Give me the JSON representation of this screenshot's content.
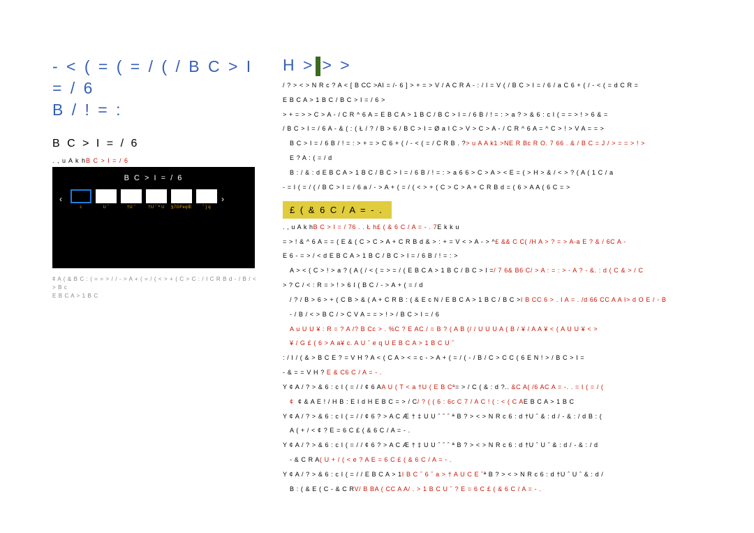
{
  "title": "- < ( = ( = / (   / B C > I = / 6\nB / ! =   :",
  "subtitle": "B C > I = / 6",
  "path": {
    "prefix": ". , u A k  h",
    "suffix": "B C > I = / 6"
  },
  "blackbox": {
    "title": "B C > I = / 6",
    "cells": [
      {
        "name": "c",
        "sel": true,
        "filled": false
      },
      {
        "name": "U ˆ",
        "sel": false,
        "filled": true
      },
      {
        "name": "†U ˆ",
        "sel": false,
        "filled": true
      },
      {
        "name": "†U ˆ ª U",
        "sel": false,
        "filled": true
      },
      {
        "name": "§7GFeqŒ",
        "sel": false,
        "filled": true
      },
      {
        "name": "ˆ ] q",
        "sel": false,
        "filled": true
      }
    ]
  },
  "footnote1": "¢ A ( & B C   : ( = = > /  / - >  A  + ( = / (  < > + ( C  > C : / I  C R B d   -  / B / < > B c",
  "footnote2": "E B C A > 1 B C",
  "right_title_prefix": "H >",
  "right_title_suffix": ">      >",
  "r1": "/ ?  > < > N R c   ?   A  < [ B CC >AI = /- 6 ]  > + = >     V   / A   C R   A   - : / I = V (   / B C > I = / 6 / a     C   6 + (   / - < ( = d C R  =",
  "r2": "E B C A > 1 B C   / B C > I = / 6 >",
  "r3": "> + = >  > C >  A   - / C R  ^ 6 A  =   E B C A > 1 B C    / B C > I = / 6   B / ! =  : >   a  ? > & 6 : c I ( = = > ! >   6  &  =",
  "r4": "/ B C > I = / 6    A  - & ( : (  Ł / ? / B > 6   / B C > I = Ø a I C >  V  > C >  A   - / C R  ^ 6 A  =  ^ C > ! >    V   A  = = >",
  "r5a": "B C > I = / 6  B / ! =   :   > + = >   C  6 + (  / - < ( = / C R  B . ?",
  "r5b": "> u A A k1 >NE R Bc R O. 7 66 . &  /  B C  = J /  > = = > ! >",
  "r6": "E ? A   : ( = / d",
  "r7": "B : /   & : d  E B C A > 1 B C    / B C > I = / 6   B / ! =  : >   a   6  6 > C > A > < E   = (  >  H > & / < >  ? ( A ( 1 C / a",
  "r8": "- =  I ( = / (   / B C > I = / 6   a  / - >  A   + ( = / (  < > + ( C  > C >  A   +   C R B d   = ( 6 > A A ( 6 C = >",
  "hl": "£ ( &   6 C / A     =   -  .",
  "r9a": ". , u A k  h",
  "r9b": "B C > I = / 76   . . Ł h",
  "r9c": "£ ( &  6 C / A   =  -  .   7",
  "r9d": "E k     k u",
  "r10a": "= > ! &  ^ 6 A  =  =  (   E & ( C  > C >  A  +  C R B d  & > : + = V <   >  A  - > ^",
  "r10b": "£  &&    C C( /H A  > ? = > A-a    E ? & / 6C    A  -",
  "r11": "E 6   -   = >   / < d   E B C A > 1 B C    / B C > I = / 6   B / ! =  : >",
  "r12a": "A > < (  C > ! > a  ? ( A ( / < ( = >    = / (  E B C A > 1 B C    / B C > I =",
  "r12b": "/ 7 6&    B6 C/ > A : =    : > -     A  ? - &.  : d ( C   &  >  / C",
  "r13": "> ? C / < : R = > ! >  6  I ( B C    / - >  A   + ( = / d",
  "r14a": "/ ? / B > 6   > + ( C  B > & ( A +  C R  B : ( & E c N /   E B C A > 1 B C    / B C >",
  "r14b": "I B  CC 6  > . I A = . /d 66 CC    A A I> d O E   / -  B",
  "r15": "-  / B / < > B C /  > C    V  A  = = > ! >   / B C > I = / 6",
  "r16a": "A u U  U ¥   : R =   ? A /",
  "r16b": "? B Cc  > . %C ?   E AC / =  B ? ( A B (/   / U  U  U  A ( B /  ¥ / A  A     ¥  < ( A   U    U ¥  < >",
  "r17a": "¥  / G   £ ( 6 > A a",
  "r17b": "¥ c. A U  ˆ   e q U E B C A > 1 B C    U  ˆ",
  "r18a": ": / I / (  & > B C E ? = V H   ?   A  < ( C A >     < = c   -  >   A  + ( = / (   -   / B / C  > C  C ( 6 E N ! >   / B C > I =",
  "r18b": "-  &   = = V H   ?",
  "r18c": "  E  &  C6 C / A    =   -  .",
  "r19a": "Y   ¢ A /  ? > & 6 : c I ( = / /  ¢  6  A",
  "r19b": "A U ( T  < a  †U  ( E B Cª",
  "r19c": "= >  / C (  & : d  ?..",
  "r19d": "  &C A( /6 AC  A      =   -.  .     =   I ( = / (",
  "r20": "¢     & A E ! / H  B : E I  d H  E B C  = >  / C",
  "r20b": "/ ? (  ( 6 : 6c C 7 / A C ! (  :    < ( C A",
  "r20c": "E B C A > 1 B C",
  "r21a": "Y  ¢ A /  ? > & 6 : c I ( = / /  ¢  6  ? > A C Æ  † ‡ U U ˆ ˆ ˆ   ª  B  ? > < > N R c  6   : d  †U ˆ  & : d  / - & : / d  B : (",
  "r21b": "A ( + / <   ¢    ? E = 6 C   £ ( &  6 C / A    =  -  .",
  "r22a": "Y  ¢ A /  ? > & 6 : c I ( = / /  ¢  6  ? > A C Æ  † ‡ U U ˆ ˆ ˆ   ª  B  ? > < > N R c  6   : d  †U ˆ  U ˆ  & : d  / - & : / d",
  "r22b": "-  &   C R  A",
  "r22c": "( U + / ( < e   ? A E = 6 C   £ ( &  6 C / A    =  -  .",
  "r23a": "Y  ¢ A /  ? > & 6 : c I ( = / /     E B C A > 1",
  "r23b": "I B C   ˆ 6 ˆ a > † A U  C E ˆ",
  "r23c": "ª  B  ? > < > N R c  6   : d  †U ˆ  U ˆ  & : d  /",
  "r24a": "B : ( & E ( C   -  &   C R",
  "r24b": "V/ B BA ( CC A A/ . >   1  B  C      U  ˆ    ? E = 6 C    £ ( &  6 C / A    =  -  ."
}
